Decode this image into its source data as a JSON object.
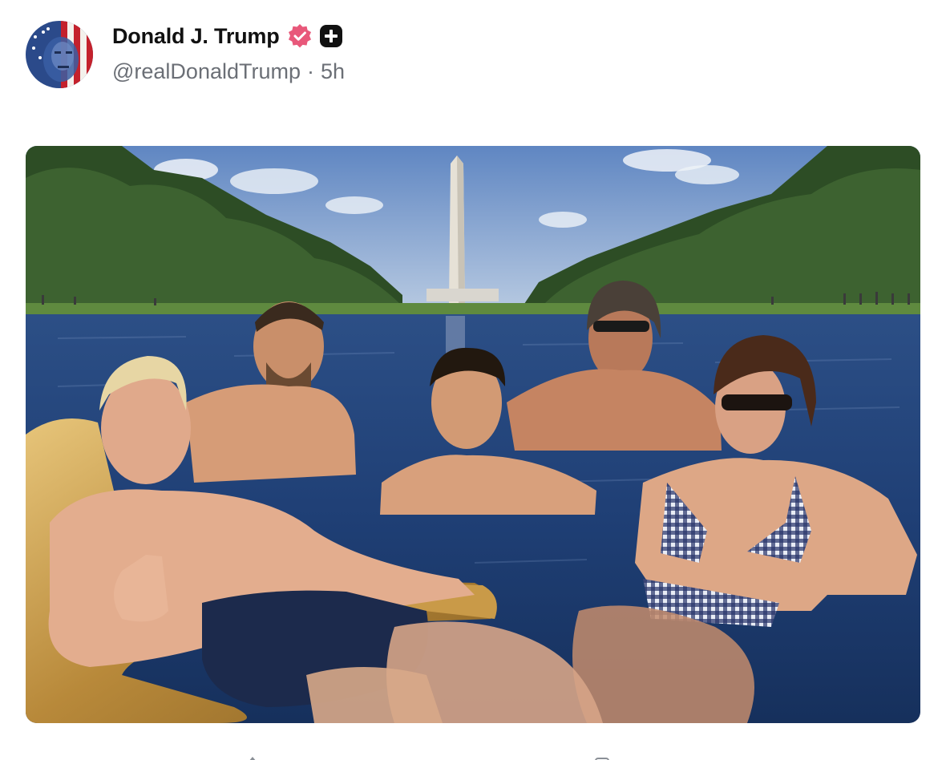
{
  "post": {
    "author": {
      "display_name": "Donald J. Trump",
      "handle": "@realDonaldTrump",
      "timestamp": "5h",
      "separator": "·",
      "avatar_icon": "flag-portrait-avatar",
      "verified_icon": "verified-badge-icon",
      "plus_icon": "plus-badge-icon"
    },
    "media": {
      "type": "image",
      "description_icon": "photo-pool-scene"
    },
    "actions": {
      "icons": [
        "reply-icon",
        "repost-icon"
      ]
    }
  },
  "colors": {
    "verified_badge": "#e8587a",
    "plus_badge": "#111111",
    "text_primary": "#111111",
    "text_secondary": "#6b6f76"
  }
}
